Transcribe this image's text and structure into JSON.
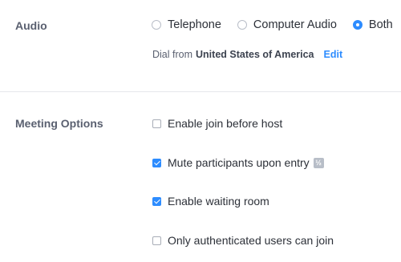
{
  "audio": {
    "section_label": "Audio",
    "options": [
      {
        "label": "Telephone",
        "checked": false
      },
      {
        "label": "Computer Audio",
        "checked": false
      },
      {
        "label": "Both",
        "checked": true
      }
    ],
    "dial_prefix": "Dial from",
    "dial_country": "United States of America",
    "edit_label": "Edit"
  },
  "meeting_options": {
    "section_label": "Meeting Options",
    "items": [
      {
        "label": "Enable join before host",
        "checked": false
      },
      {
        "label": "Mute participants upon entry",
        "checked": true,
        "badge_icon": "info-badge-icon"
      },
      {
        "label": "Enable waiting room",
        "checked": true
      },
      {
        "label": "Only authenticated users can join",
        "checked": false
      }
    ]
  },
  "colors": {
    "accent": "#2d8cff",
    "label_gray": "#5a6070",
    "divider": "#e5e7eb"
  }
}
